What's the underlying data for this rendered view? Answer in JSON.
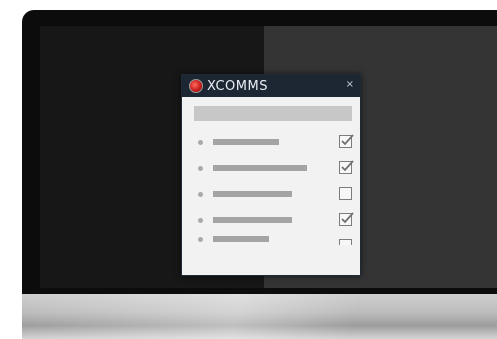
{
  "app": {
    "title": "XCOMMS",
    "close_glyph": "×",
    "logo_icon": "red-globe-logo"
  },
  "colors": {
    "titlebar": "#1d2733",
    "dialog_bg": "#f2f2f2",
    "logo_red": "#c81e1e",
    "screen_left": "#171717",
    "screen_right": "#343434"
  },
  "items": [
    {
      "checked": true
    },
    {
      "checked": true
    },
    {
      "checked": false
    },
    {
      "checked": true
    },
    {
      "checked": false
    }
  ]
}
